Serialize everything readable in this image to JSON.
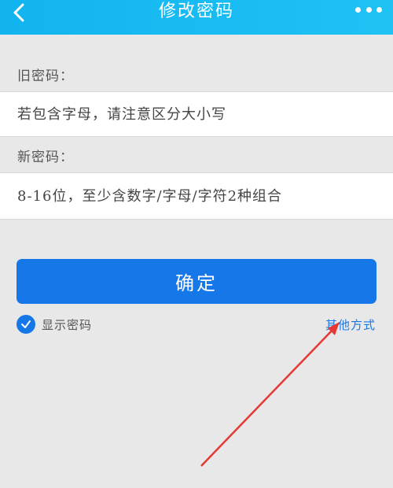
{
  "header": {
    "title": "修改密码",
    "back_icon": "chevron-left-icon",
    "more_icon": "more-dots-icon",
    "bg_color": "#1ec2f3"
  },
  "form": {
    "old_password_label": "旧密码：",
    "old_password_placeholder": "若包含字母，请注意区分大小写",
    "new_password_label": "新密码：",
    "new_password_placeholder": "8-16位，至少含数字/字母/字符2种组合"
  },
  "confirm_button": {
    "label": "确定",
    "color": "#1677e8"
  },
  "options": {
    "show_password_label": "显示密码",
    "show_password_checked": true,
    "other_methods_label": "其他方式"
  },
  "annotation": {
    "arrow_color": "#e53935"
  }
}
